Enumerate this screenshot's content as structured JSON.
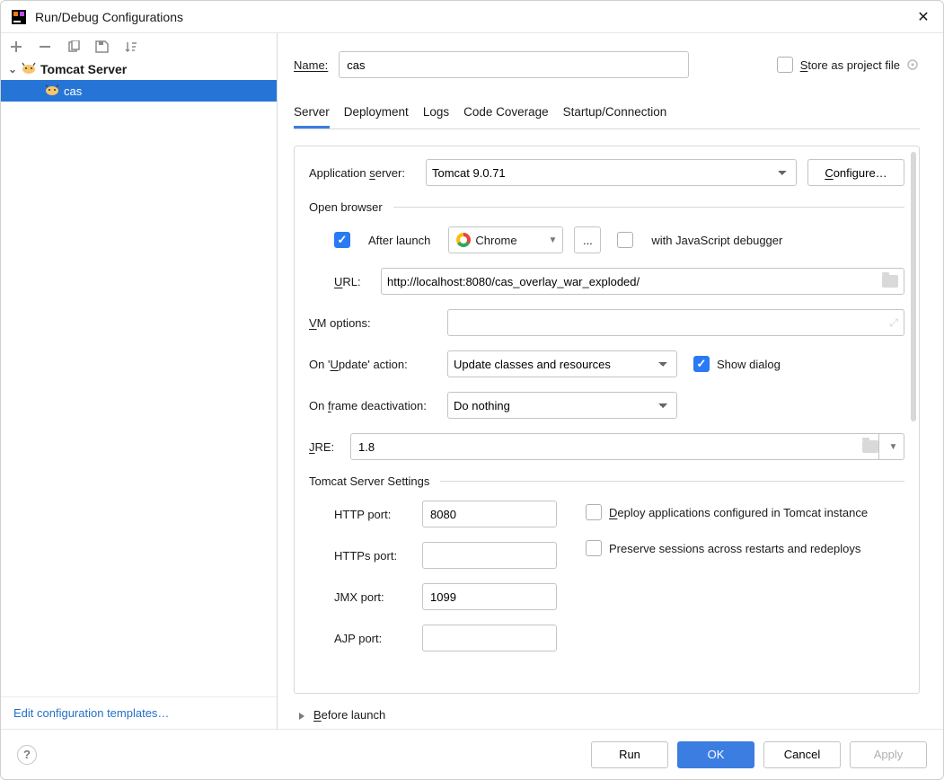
{
  "title": "Run/Debug Configurations",
  "tree": {
    "group_label": "Tomcat Server",
    "item_label": "cas"
  },
  "left_footer_link": "Edit configuration templates…",
  "name": {
    "label": "Name:",
    "value": "cas"
  },
  "store_as": "Store as project file",
  "tabs": {
    "server": "Server",
    "deployment": "Deployment",
    "logs": "Logs",
    "code_coverage": "Code Coverage",
    "startup": "Startup/Connection"
  },
  "app_server": {
    "label": "Application server:",
    "value": "Tomcat 9.0.71",
    "configure": "Configure…"
  },
  "open_browser": {
    "title": "Open browser",
    "after_launch": "After launch",
    "browser": "Chrome",
    "dots": "...",
    "js_dbg": "with JavaScript debugger",
    "url_label": "URL:",
    "url_value": "http://localhost:8080/cas_overlay_war_exploded/"
  },
  "vm_options_label": "VM options:",
  "update_action": {
    "label": "On 'Update' action:",
    "value": "Update classes and resources",
    "show_dialog": "Show dialog"
  },
  "frame_deact": {
    "label": "On frame deactivation:",
    "value": "Do nothing"
  },
  "jre": {
    "label": "JRE:",
    "value": "1.8"
  },
  "tomcat_settings": {
    "title": "Tomcat Server Settings",
    "http": {
      "label": "HTTP port:",
      "value": "8080"
    },
    "https": {
      "label": "HTTPs port:",
      "value": ""
    },
    "jmx": {
      "label": "JMX port:",
      "value": "1099"
    },
    "ajp": {
      "label": "AJP port:",
      "value": ""
    },
    "deploy_cb": "Deploy applications configured in Tomcat instance",
    "preserve_cb": "Preserve sessions across restarts and redeploys"
  },
  "before_launch": "Before launch",
  "footer": {
    "run": "Run",
    "ok": "OK",
    "cancel": "Cancel",
    "apply": "Apply"
  }
}
